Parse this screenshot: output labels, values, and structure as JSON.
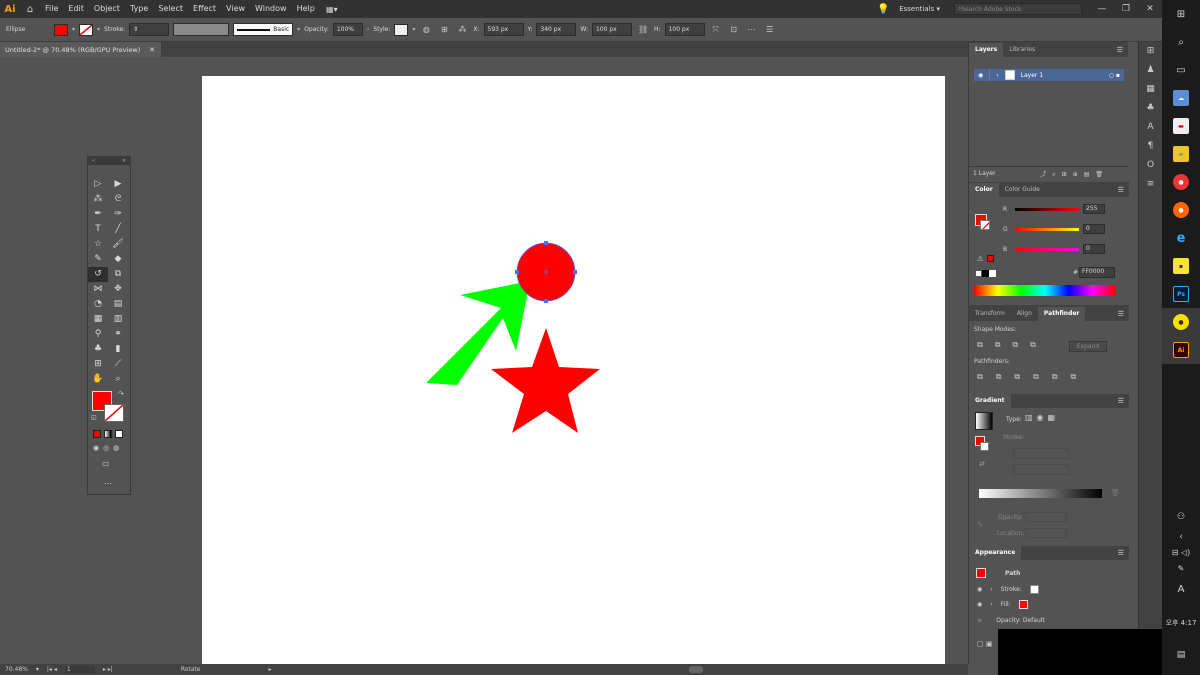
{
  "app": {
    "logo": "Ai"
  },
  "menu": [
    "File",
    "Edit",
    "Object",
    "Type",
    "Select",
    "Effect",
    "View",
    "Window",
    "Help"
  ],
  "workspace": "Essentials",
  "search": {
    "placeholder": "Search Adobe Stock"
  },
  "control": {
    "selection": "Ellipse",
    "fill_color": "#ff0000",
    "stroke_label": "Stroke:",
    "brush": "Basic",
    "opacity_label": "Opacity:",
    "opacity": "100%",
    "style_label": "Style:",
    "x_label": "X:",
    "x": "593 px",
    "y_label": "Y:",
    "y": "340 px",
    "w_label": "W:",
    "w": "100 px",
    "h_label": "H:",
    "h": "100 px"
  },
  "document": {
    "tab": "Untitled-2* @ 70.48% (RGB/GPU Preview)"
  },
  "artwork": {
    "circle_color": "#ff0000",
    "arrow_color": "#00ff00",
    "star_color": "#ff0000",
    "selection_color": "#4a6cff"
  },
  "layers": {
    "tabs": [
      "Layers",
      "Libraries"
    ],
    "items": [
      {
        "name": "Layer 1"
      }
    ],
    "count": "1 Layer"
  },
  "color": {
    "tabs": [
      "Color",
      "Color Guide"
    ],
    "r_label": "R",
    "r": "255",
    "g_label": "G",
    "g": "0",
    "b_label": "B",
    "b": "0",
    "hex_label": "#",
    "hex": "FF0000"
  },
  "pathfinder": {
    "tabs": [
      "Transform",
      "Align",
      "Pathfinder"
    ],
    "shape_modes": "Shape Modes:",
    "expand": "Expand",
    "pathfinders": "Pathfinders:"
  },
  "gradient": {
    "title": "Gradient",
    "type_label": "Type:",
    "stroke_label": "Stroke:",
    "opacity_label": "Opacity:",
    "location_label": "Location:"
  },
  "appearance": {
    "title": "Appearance",
    "object": "Path",
    "stroke_label": "Stroke:",
    "fill_label": "Fill:",
    "opacity_label": "Opacity:",
    "opacity_value": "Default"
  },
  "status": {
    "zoom": "70.48%",
    "artboard": "1",
    "tool": "Rotate"
  },
  "taskbar": {
    "time": "오후 4:17",
    "ime": "A"
  }
}
